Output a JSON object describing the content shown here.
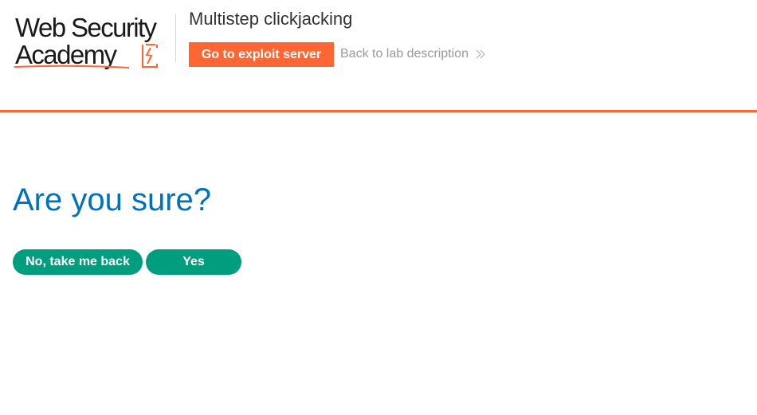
{
  "header": {
    "logo": {
      "line1": "Web Security",
      "line2": "Academy"
    },
    "lab_title": "Multistep clickjacking",
    "exploit_button_label": "Go to exploit server",
    "back_link_label": "Back to lab description",
    "accent_color": "#ff6633"
  },
  "main": {
    "heading": "Are you sure?",
    "no_button_label": "No, take me back",
    "yes_button_label": "Yes",
    "button_color": "#009e7f",
    "heading_color": "#0071bc"
  },
  "icons": {
    "logo_bolt": "lightning-bolt-icon",
    "back_chevron": "double-chevron-right-icon"
  }
}
